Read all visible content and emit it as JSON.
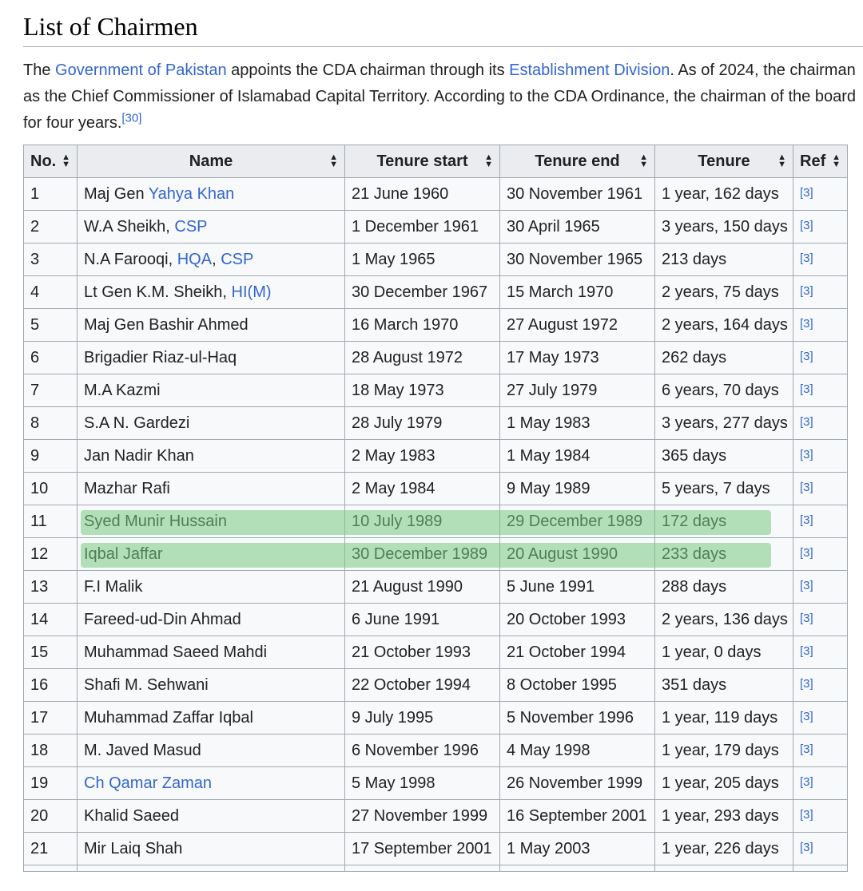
{
  "heading": "List of Chairmen",
  "intro": {
    "l1_pre": "The ",
    "l1_link1": "Government of Pakistan",
    "l1_mid": " appoints the CDA chairman through its ",
    "l1_link2": "Establishment Division",
    "l1_post": ". As of 2024, the chairman",
    "l2": "as the Chief Commissioner of Islamabad Capital Territory. According to the CDA Ordinance, the chairman of the board",
    "l3": "for four years.",
    "l3_ref": "[30]"
  },
  "table": {
    "headers": [
      "No.",
      "Name",
      "Tenure start",
      "Tenure end",
      "Tenure",
      "Ref"
    ],
    "sort_icon": "sort-arrows-icon",
    "rows": [
      {
        "no": "1",
        "name": [
          {
            "t": "Maj Gen "
          },
          {
            "t": "Yahya Khan",
            "link": true
          }
        ],
        "start": "21 June 1960",
        "end": "30 November 1961",
        "tenure": "1 year, 162 days",
        "ref": "[3]"
      },
      {
        "no": "2",
        "name": [
          {
            "t": "W.A Sheikh, "
          },
          {
            "t": "CSP",
            "link": true
          }
        ],
        "start": "1 December 1961",
        "end": "30 April 1965",
        "tenure": "3 years, 150 days",
        "ref": "[3]"
      },
      {
        "no": "3",
        "name": [
          {
            "t": "N.A Farooqi, "
          },
          {
            "t": "HQA",
            "link": true
          },
          {
            "t": ", "
          },
          {
            "t": "CSP",
            "link": true
          }
        ],
        "start": "1 May 1965",
        "end": "30 November 1965",
        "tenure": "213 days",
        "ref": "[3]"
      },
      {
        "no": "4",
        "name": [
          {
            "t": "Lt Gen K.M. Sheikh, "
          },
          {
            "t": "HI(M)",
            "link": true
          }
        ],
        "start": "30 December 1967",
        "end": "15 March 1970",
        "tenure": "2 years, 75 days",
        "ref": "[3]"
      },
      {
        "no": "5",
        "name": [
          {
            "t": "Maj Gen Bashir Ahmed"
          }
        ],
        "start": "16 March 1970",
        "end": "27 August 1972",
        "tenure": "2 years, 164 days",
        "ref": "[3]"
      },
      {
        "no": "6",
        "name": [
          {
            "t": "Brigadier Riaz-ul-Haq"
          }
        ],
        "start": "28 August 1972",
        "end": "17 May 1973",
        "tenure": "262 days",
        "ref": "[3]"
      },
      {
        "no": "7",
        "name": [
          {
            "t": "M.A Kazmi"
          }
        ],
        "start": "18 May 1973",
        "end": "27 July 1979",
        "tenure": "6 years, 70 days",
        "ref": "[3]"
      },
      {
        "no": "8",
        "name": [
          {
            "t": "S.A N. Gardezi"
          }
        ],
        "start": "28 July 1979",
        "end": "1 May 1983",
        "tenure": "3 years, 277 days",
        "ref": "[3]"
      },
      {
        "no": "9",
        "name": [
          {
            "t": "Jan Nadir Khan"
          }
        ],
        "start": "2 May 1983",
        "end": "1 May 1984",
        "tenure": "365 days",
        "ref": "[3]"
      },
      {
        "no": "10",
        "name": [
          {
            "t": "Mazhar Rafi"
          }
        ],
        "start": "2 May 1984",
        "end": "9 May 1989",
        "tenure": "5 years, 7 days",
        "ref": "[3]"
      },
      {
        "no": "11",
        "name": [
          {
            "t": "Syed Munir Hussain"
          }
        ],
        "start": "10 July 1989",
        "end": "29 December 1989",
        "tenure": "172 days",
        "ref": "[3]"
      },
      {
        "no": "12",
        "name": [
          {
            "t": "Iqbal Jaffar"
          }
        ],
        "start": "30 December 1989",
        "end": "20 August 1990",
        "tenure": "233 days",
        "ref": "[3]"
      },
      {
        "no": "13",
        "name": [
          {
            "t": "F.I Malik"
          }
        ],
        "start": "21 August 1990",
        "end": "5 June 1991",
        "tenure": "288 days",
        "ref": "[3]"
      },
      {
        "no": "14",
        "name": [
          {
            "t": "Fareed-ud-Din Ahmad"
          }
        ],
        "start": "6 June 1991",
        "end": "20 October 1993",
        "tenure": "2 years, 136 days",
        "ref": "[3]"
      },
      {
        "no": "15",
        "name": [
          {
            "t": "Muhammad Saeed Mahdi"
          }
        ],
        "start": "21 October 1993",
        "end": "21 October 1994",
        "tenure": "1 year, 0 days",
        "ref": "[3]"
      },
      {
        "no": "16",
        "name": [
          {
            "t": "Shafi M. Sehwani"
          }
        ],
        "start": "22 October 1994",
        "end": "8 October 1995",
        "tenure": "351 days",
        "ref": "[3]"
      },
      {
        "no": "17",
        "name": [
          {
            "t": "Muhammad Zaffar Iqbal"
          }
        ],
        "start": "9 July 1995",
        "end": "5 November 1996",
        "tenure": "1 year, 119 days",
        "ref": "[3]"
      },
      {
        "no": "18",
        "name": [
          {
            "t": "M. Javed Masud"
          }
        ],
        "start": "6 November 1996",
        "end": "4 May 1998",
        "tenure": "1 year, 179 days",
        "ref": "[3]"
      },
      {
        "no": "19",
        "name": [
          {
            "t": "Ch Qamar Zaman",
            "link": true
          }
        ],
        "start": "5 May 1998",
        "end": "26 November 1999",
        "tenure": "1 year, 205 days",
        "ref": "[3]"
      },
      {
        "no": "20",
        "name": [
          {
            "t": "Khalid Saeed"
          }
        ],
        "start": "27 November 1999",
        "end": "16 September 2001",
        "tenure": "1 year, 293 days",
        "ref": "[3]"
      },
      {
        "no": "21",
        "name": [
          {
            "t": "Mir Laiq Shah"
          }
        ],
        "start": "17 September 2001",
        "end": "1 May 2003",
        "tenure": "1 year, 226 days",
        "ref": "[3]"
      }
    ]
  },
  "highlight": {
    "rows": [
      "11",
      "12"
    ],
    "color": "#78c882"
  },
  "colors": {
    "link": "#3366cc",
    "header_bg": "#eaecf0",
    "cell_bg": "#f8f9fa",
    "border": "#a2a9b1"
  }
}
